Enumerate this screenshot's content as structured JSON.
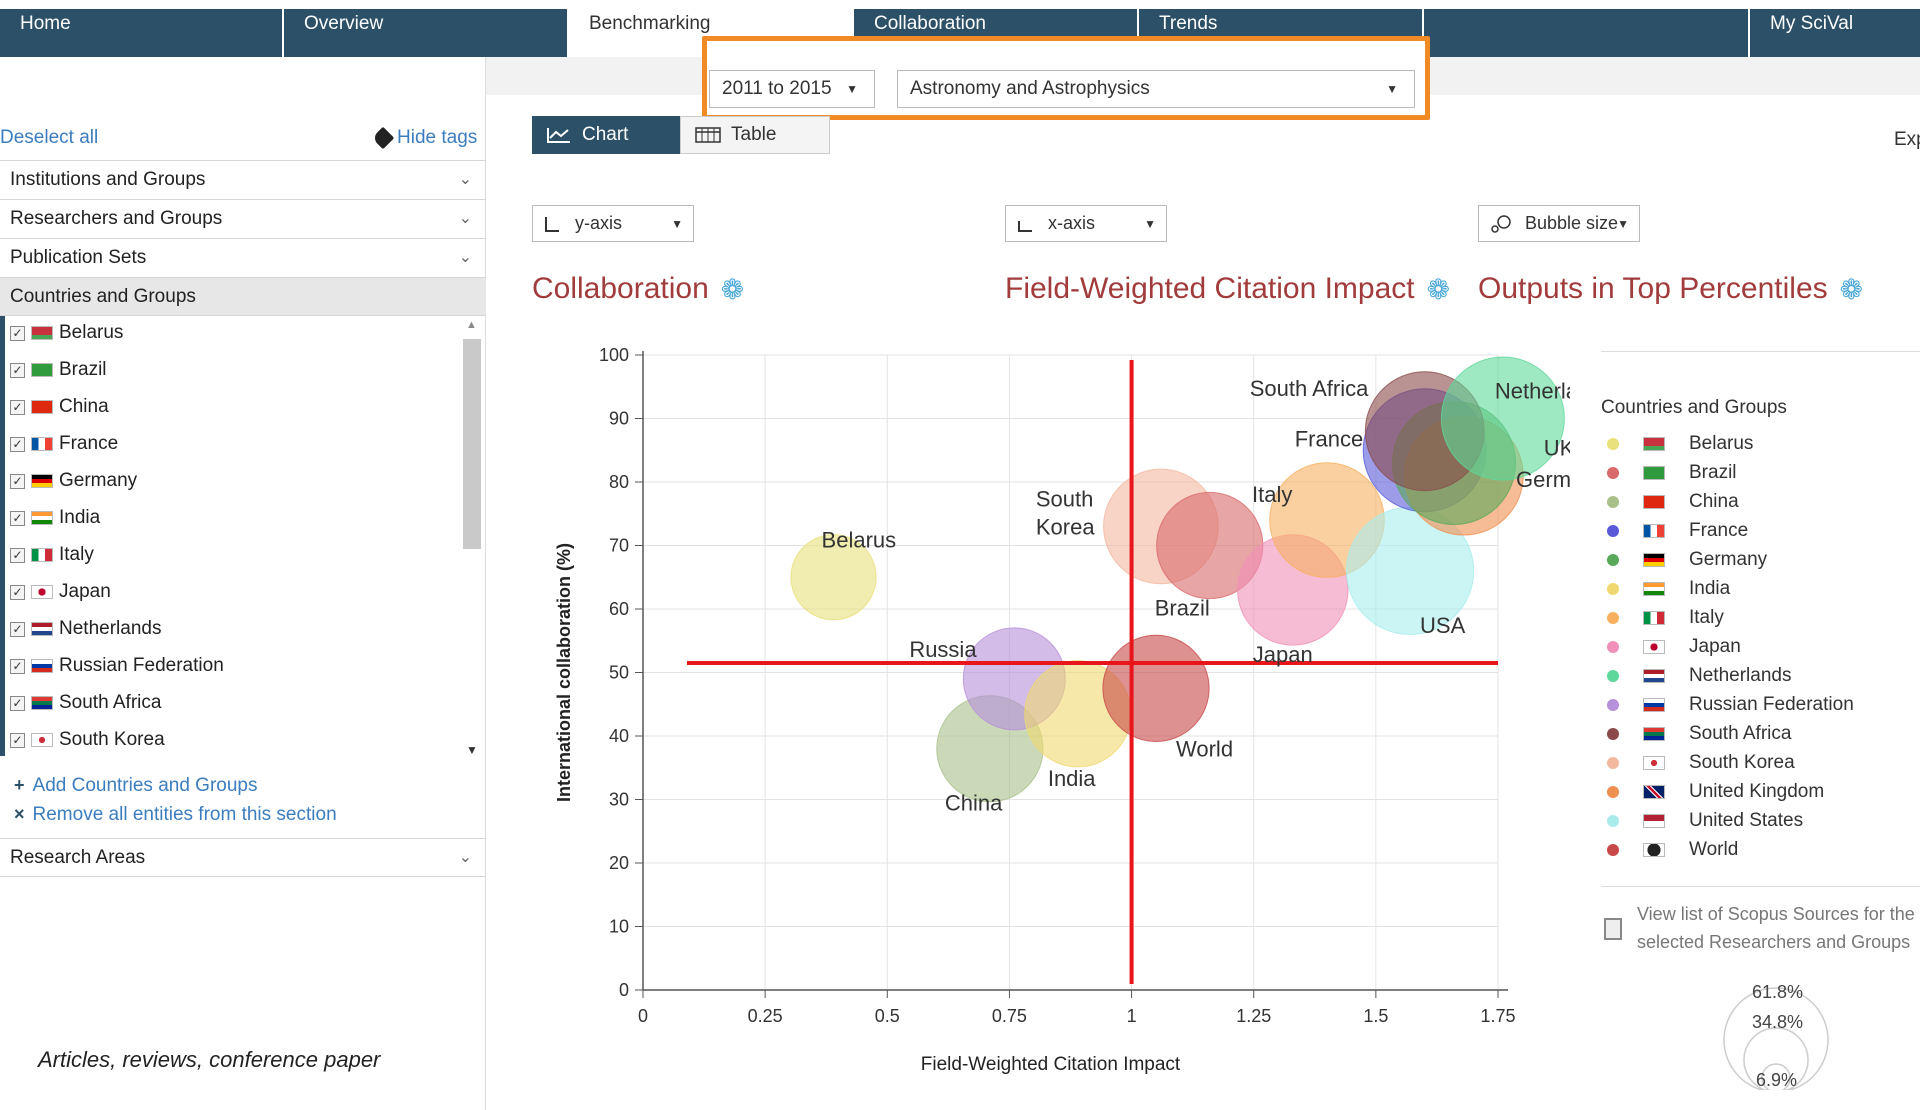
{
  "nav": {
    "tabs": [
      "Home",
      "Overview",
      "Benchmarking",
      "Collaboration",
      "Trends",
      "",
      "My SciVal"
    ]
  },
  "sidebar": {
    "deselect_all": "Deselect all",
    "hide_tags": "Hide tags",
    "sections": {
      "institutions": "Institutions and Groups",
      "researchers": "Researchers and Groups",
      "publication_sets": "Publication Sets",
      "countries": "Countries and Groups",
      "research_areas": "Research Areas"
    },
    "countries": [
      "Belarus",
      "Brazil",
      "China",
      "France",
      "Germany",
      "India",
      "Italy",
      "Japan",
      "Netherlands",
      "Russian Federation",
      "South Africa",
      "South Korea"
    ],
    "add_countries": "Add Countries and Groups",
    "remove_all": "Remove all entities from this section",
    "footnote": "Articles, reviews, conference paper"
  },
  "filters": {
    "year_range": "2011 to 2015",
    "subject_area": "Astronomy and Astrophysics"
  },
  "view": {
    "chart_label": "Chart",
    "table_label": "Table",
    "export_fragment": "Exp"
  },
  "axis_selectors": {
    "y": "y-axis",
    "x": "x-axis",
    "bubble": "Bubble size"
  },
  "metric_titles": {
    "y": "Collaboration",
    "x": "Field-Weighted Citation Impact",
    "bubble": "Outputs in Top Percentiles"
  },
  "legend": {
    "title": "Countries and Groups",
    "items": [
      {
        "name": "Belarus",
        "color": "#e8e07a"
      },
      {
        "name": "Brazil",
        "color": "#d9696a"
      },
      {
        "name": "China",
        "color": "#a8c08a"
      },
      {
        "name": "France",
        "color": "#5a5ad8"
      },
      {
        "name": "Germany",
        "color": "#5aa85a"
      },
      {
        "name": "India",
        "color": "#f0d870"
      },
      {
        "name": "Italy",
        "color": "#f8b060"
      },
      {
        "name": "Japan",
        "color": "#f090b8"
      },
      {
        "name": "Netherlands",
        "color": "#5ed89a"
      },
      {
        "name": "Russian Federation",
        "color": "#b690d8"
      },
      {
        "name": "South Africa",
        "color": "#8a4a4a"
      },
      {
        "name": "South Korea",
        "color": "#f4b8a0"
      },
      {
        "name": "United Kingdom",
        "color": "#f09050"
      },
      {
        "name": "United States",
        "color": "#a8ecec"
      },
      {
        "name": "World",
        "color": "#c84848"
      }
    ],
    "scopus_link": "View list of Scopus Sources for the selected Researchers and Groups",
    "percentiles": [
      "61.8%",
      "34.8%",
      "6.9%"
    ]
  },
  "chart_data": {
    "type": "scatter",
    "xlabel": "Field-Weighted Citation Impact",
    "ylabel": "International collaboration (%)",
    "xlim": [
      0,
      1.75
    ],
    "ylim": [
      0,
      100
    ],
    "xticks": [
      "0",
      "0.25",
      "0.5",
      "0.75",
      "1",
      "1.25",
      "1.5",
      "1.75"
    ],
    "yticks": [
      "0",
      "10",
      "20",
      "30",
      "40",
      "50",
      "60",
      "70",
      "80",
      "90",
      "100"
    ],
    "grid": true,
    "reference_lines": {
      "x": 1.0,
      "y": 51.5
    },
    "points": [
      {
        "name": "Belarus",
        "x": 0.39,
        "y": 65,
        "size": 0.3,
        "color": "#e8e07a",
        "label": "Belarus"
      },
      {
        "name": "China",
        "x": 0.71,
        "y": 38,
        "size": 0.55,
        "color": "#a8c08a",
        "label": "China"
      },
      {
        "name": "Russia",
        "x": 0.76,
        "y": 49,
        "size": 0.5,
        "color": "#b690d8",
        "label": "Russia"
      },
      {
        "name": "India",
        "x": 0.89,
        "y": 43.5,
        "size": 0.55,
        "color": "#f0d870",
        "label": "India"
      },
      {
        "name": "World",
        "x": 1.05,
        "y": 47.5,
        "size": 0.55,
        "color": "#c84848",
        "label": "World"
      },
      {
        "name": "South Korea",
        "x": 1.06,
        "y": 73,
        "size": 0.65,
        "color": "#f4b8a0",
        "label": "South Korea"
      },
      {
        "name": "Brazil",
        "x": 1.16,
        "y": 70,
        "size": 0.55,
        "color": "#d9696a",
        "label": "Brazil"
      },
      {
        "name": "Japan",
        "x": 1.33,
        "y": 63,
        "size": 0.6,
        "color": "#f090b8",
        "label": "Japan"
      },
      {
        "name": "Italy",
        "x": 1.4,
        "y": 74,
        "size": 0.65,
        "color": "#f8b060",
        "label": "Italy"
      },
      {
        "name": "USA",
        "x": 1.57,
        "y": 66,
        "size": 0.8,
        "color": "#a8ecec",
        "label": "USA"
      },
      {
        "name": "France",
        "x": 1.6,
        "y": 85,
        "size": 0.75,
        "color": "#5a5ad8",
        "label": "France"
      },
      {
        "name": "UK",
        "x": 1.68,
        "y": 81,
        "size": 0.7,
        "color": "#f09050",
        "label": "UK"
      },
      {
        "name": "Germany",
        "x": 1.66,
        "y": 83,
        "size": 0.75,
        "color": "#5aa85a",
        "label": "Germany"
      },
      {
        "name": "South Africa",
        "x": 1.6,
        "y": 88,
        "size": 0.7,
        "color": "#8a4a4a",
        "label": "South Africa"
      },
      {
        "name": "Netherlands",
        "x": 1.76,
        "y": 90,
        "size": 0.75,
        "color": "#5ed89a",
        "label": "Netherlands"
      }
    ]
  }
}
